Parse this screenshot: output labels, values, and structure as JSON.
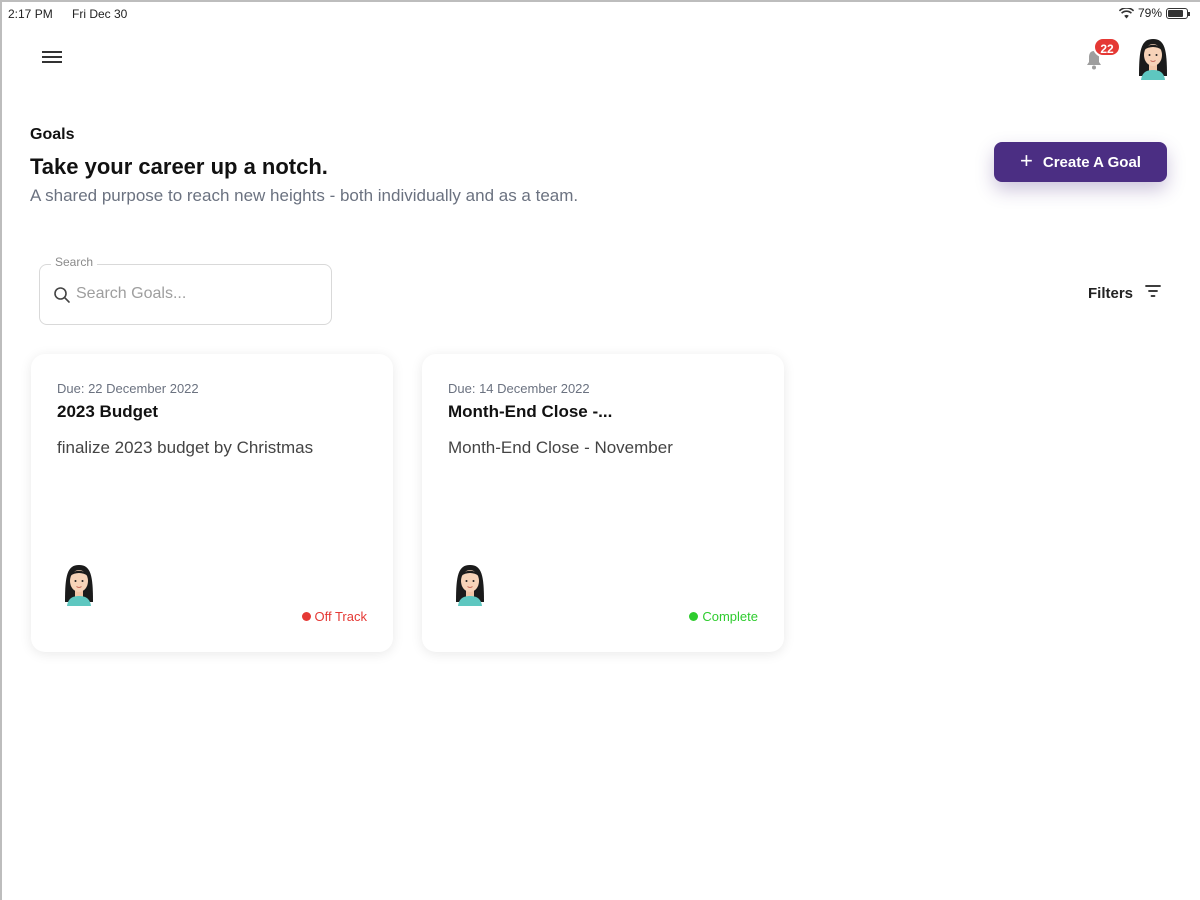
{
  "status_bar": {
    "time": "2:17 PM",
    "date": "Fri Dec 30",
    "battery": "79%"
  },
  "header": {
    "notification_count": "22",
    "icons": {
      "menu": "menu-icon",
      "bell": "bell-icon",
      "avatar": "user-avatar"
    }
  },
  "page": {
    "label": "Goals",
    "title": "Take your career up a notch.",
    "subtitle": "A shared purpose to reach new heights - both individually and as a team.",
    "create_button": "Create A Goal"
  },
  "search": {
    "legend": "Search",
    "placeholder": "Search Goals...",
    "value": ""
  },
  "filters": {
    "label": "Filters"
  },
  "goals": [
    {
      "due": "Due: 22 December 2022",
      "title": "2023 Budget",
      "description": "finalize 2023 budget by Christmas",
      "status": "Off Track",
      "status_color": "#e53935"
    },
    {
      "due": "Due: 14 December 2022",
      "title": "Month-End Close -...",
      "description": "Month-End Close - November",
      "status": "Complete",
      "status_color": "#2ecc2e"
    }
  ],
  "colors": {
    "primary": "#4b2e83",
    "badge": "#e53935"
  }
}
